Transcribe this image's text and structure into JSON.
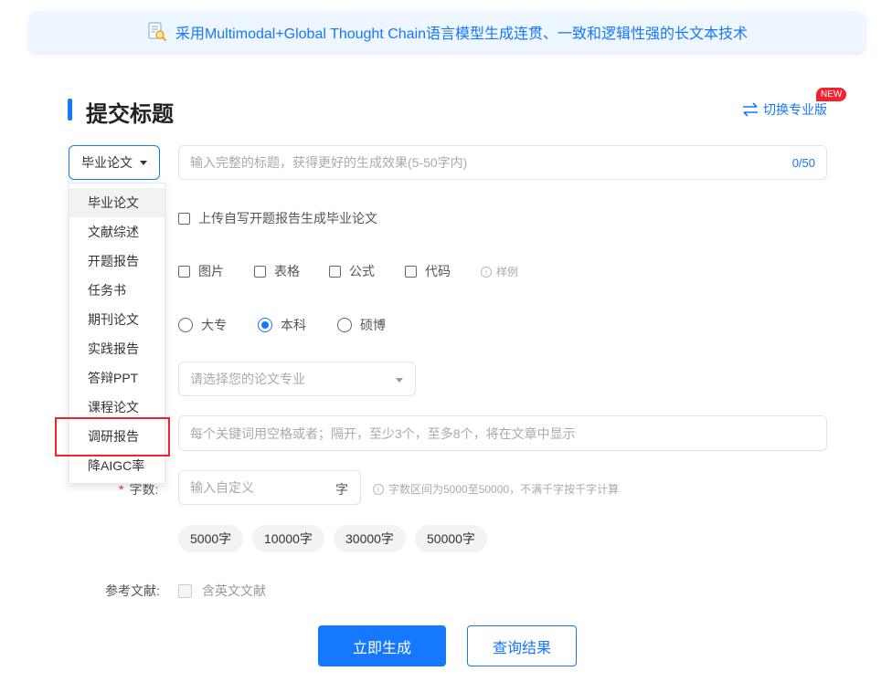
{
  "banner": {
    "text": "采用Multimodal+Global Thought Chain语言模型生成连贯、一致和逻辑性强的长文本技术",
    "icon": "document-magnifier-icon"
  },
  "header": {
    "title": "提交标题",
    "switch_label": "切换专业版",
    "new_badge": "NEW"
  },
  "type_select": {
    "value": "毕业论文"
  },
  "title_input": {
    "placeholder": "输入完整的标题，获得更好的生成效果(5-50字内)",
    "counter": "0/50"
  },
  "dropdown": {
    "items": [
      "毕业论文",
      "文献综述",
      "开题报告",
      "任务书",
      "期刊论文",
      "实践报告",
      "答辩PPT",
      "课程论文",
      "调研报告",
      "降AIGC率"
    ],
    "active_index": 0,
    "highlighted_index": 8
  },
  "upload_option": {
    "label": "上传自写开题报告生成毕业论文"
  },
  "content_options": {
    "items": [
      "图片",
      "表格",
      "公式",
      "代码"
    ],
    "hint": "样例"
  },
  "degree": {
    "options": [
      "大专",
      "本科",
      "硕博"
    ],
    "selected": "本科"
  },
  "major": {
    "placeholder": "请选择您的论文专业"
  },
  "keywords": {
    "placeholder": "每个关键词用空格或者；隔开，至少3个，至多8个，将在文章中显示"
  },
  "word_count": {
    "label": "字数:",
    "placeholder": "输入自定义",
    "unit": "字",
    "hint": "字数区间为5000至50000，不满千字按千字计算",
    "presets": [
      "5000字",
      "10000字",
      "30000字",
      "50000字"
    ]
  },
  "references": {
    "label": "参考文献:",
    "option": "含英文文献"
  },
  "actions": {
    "generate": "立即生成",
    "query": "查询结果"
  },
  "colors": {
    "accent": "#1677ff",
    "danger": "#f5222d"
  }
}
